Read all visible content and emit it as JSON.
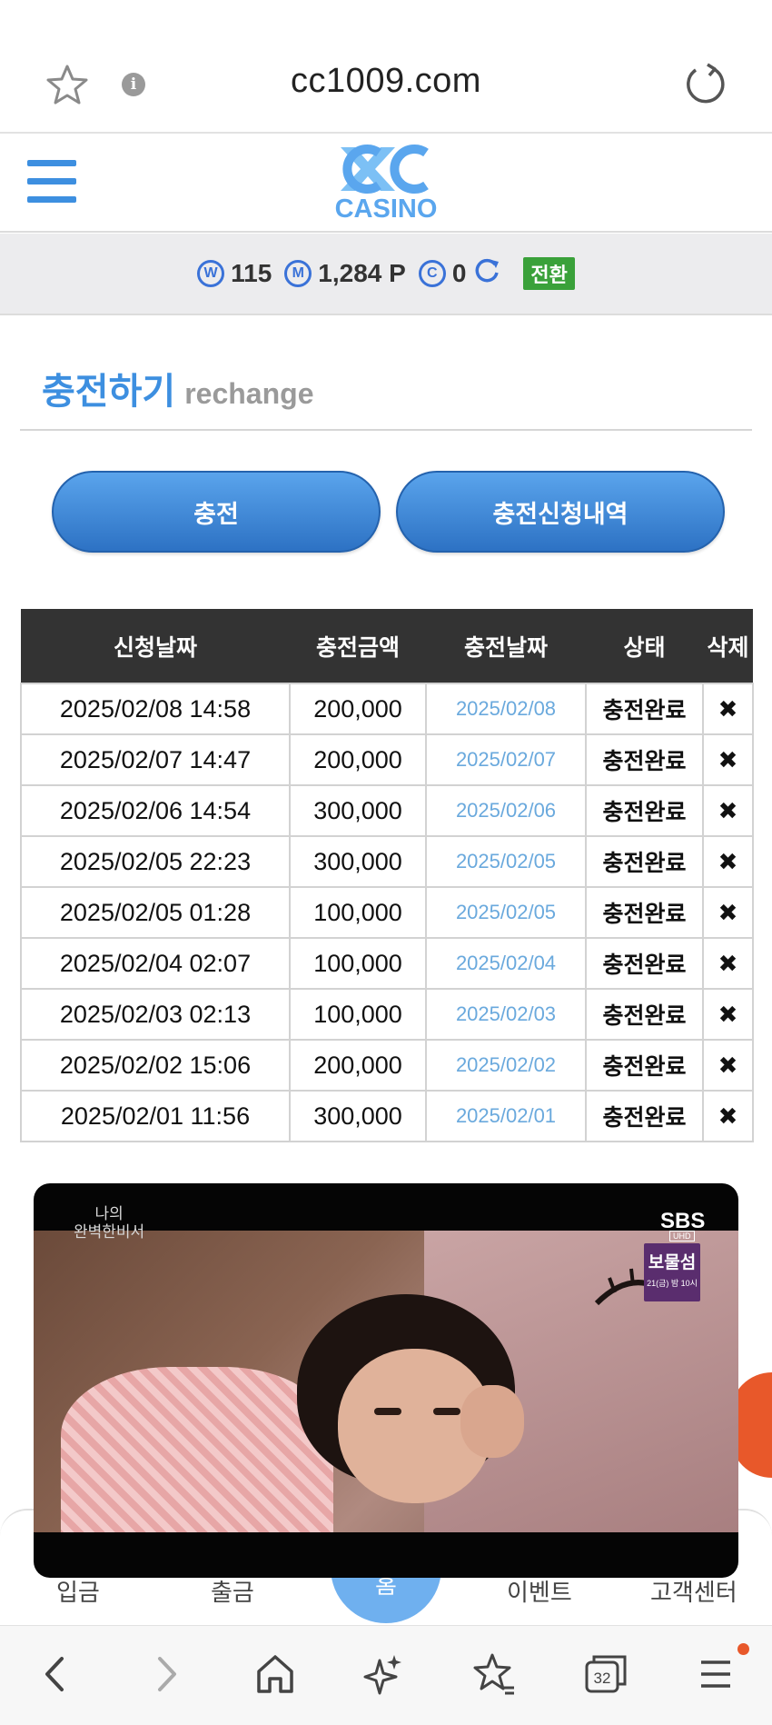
{
  "browser": {
    "url": "cc1009.com",
    "tab_count": "32"
  },
  "site": {
    "logo_text": "CASINO",
    "logo_color": "#5aa6ee"
  },
  "balance": {
    "w_icon": "W",
    "w_value": "115",
    "m_icon": "M",
    "m_value": "1,284 P",
    "c_icon": "C",
    "c_value": "0",
    "convert_label": "전환"
  },
  "section": {
    "title_ko": "충전하기",
    "title_en": "rechange"
  },
  "buttons": {
    "charge": "충전",
    "history": "충전신청내역"
  },
  "table": {
    "headers": [
      "신청날짜",
      "충전금액",
      "충전날짜",
      "상태",
      "삭제"
    ],
    "rows": [
      {
        "request_date": "2025/02/08 14:58",
        "amount": "200,000",
        "charge_date": "2025/02/08",
        "status": "충전완료",
        "delete": "✖"
      },
      {
        "request_date": "2025/02/07 14:47",
        "amount": "200,000",
        "charge_date": "2025/02/07",
        "status": "충전완료",
        "delete": "✖"
      },
      {
        "request_date": "2025/02/06 14:54",
        "amount": "300,000",
        "charge_date": "2025/02/06",
        "status": "충전완료",
        "delete": "✖"
      },
      {
        "request_date": "2025/02/05 22:23",
        "amount": "300,000",
        "charge_date": "2025/02/05",
        "status": "충전완료",
        "delete": "✖"
      },
      {
        "request_date": "2025/02/05 01:28",
        "amount": "100,000",
        "charge_date": "2025/02/05",
        "status": "충전완료",
        "delete": "✖"
      },
      {
        "request_date": "2025/02/04 02:07",
        "amount": "100,000",
        "charge_date": "2025/02/04",
        "status": "충전완료",
        "delete": "✖"
      },
      {
        "request_date": "2025/02/03 02:13",
        "amount": "100,000",
        "charge_date": "2025/02/03",
        "status": "충전완료",
        "delete": "✖"
      },
      {
        "request_date": "2025/02/02 15:06",
        "amount": "200,000",
        "charge_date": "2025/02/02",
        "status": "충전완료",
        "delete": "✖"
      },
      {
        "request_date": "2025/02/01 11:56",
        "amount": "300,000",
        "charge_date": "2025/02/01",
        "status": "충전완료",
        "delete": "✖"
      }
    ]
  },
  "video": {
    "show_title_line1": "나의",
    "show_title_line2": "완벽한비서",
    "channel": "SBS",
    "channel_sub": "UHD",
    "promo_title": "보물섬",
    "promo_sub": "21(금) 밤 10시"
  },
  "bottom_nav": {
    "deposit": "입금",
    "withdraw": "출금",
    "home": "홈",
    "event": "이벤트",
    "support": "고객센터"
  },
  "colors": {
    "accent": "#3d8fe0",
    "table_header": "#333333",
    "convert": "#3aa13a",
    "notification": "#e8582a"
  }
}
